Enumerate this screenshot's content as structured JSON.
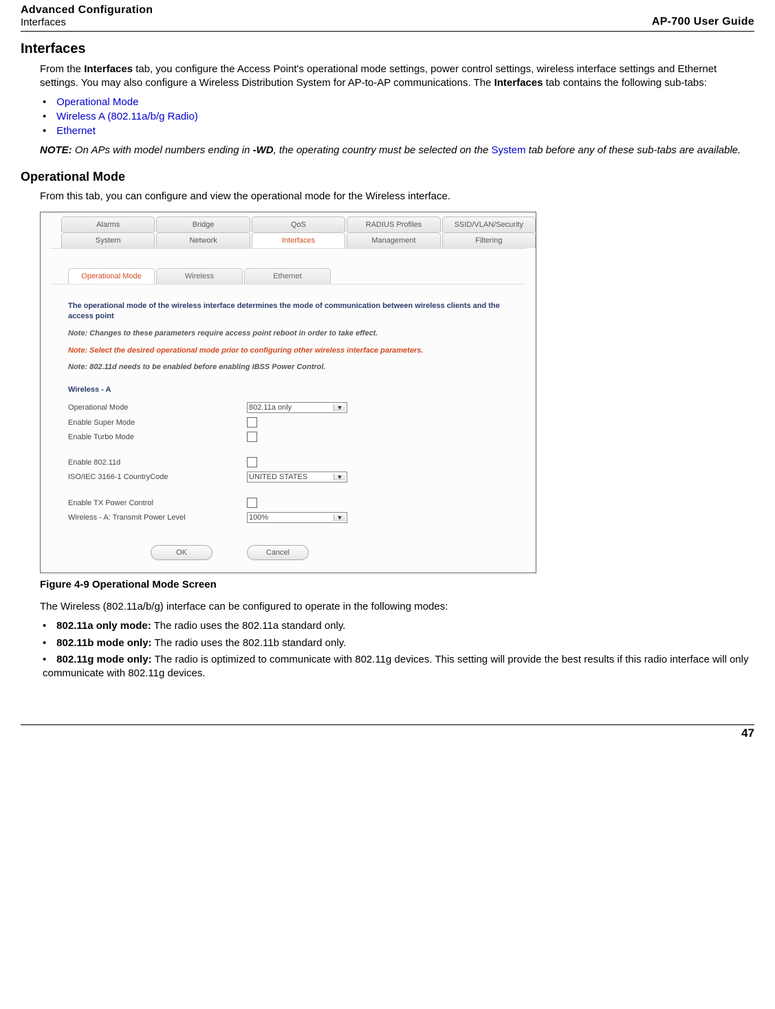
{
  "header": {
    "left_top": "Advanced Configuration",
    "left_bottom": "Interfaces",
    "right": "AP-700 User Guide"
  },
  "section_title": "Interfaces",
  "intro_p1_a": "From the ",
  "intro_p1_b": " tab, you configure the Access Point's operational mode settings, power control settings, wireless interface settings and Ethernet settings. You may also configure a Wireless Distribution System for AP-to-AP communications. The ",
  "intro_p1_c": " tab contains the following sub-tabs:",
  "intro_bold_interfaces": "Interfaces",
  "bullets_links": {
    "op_mode": "Operational Mode",
    "wireless_a": "Wireless A (802.11a/b/g Radio)",
    "ethernet": "Ethernet"
  },
  "note": {
    "label": "NOTE:",
    "a": "On APs with model numbers ending in ",
    "wd": "-WD",
    "b": ", the operating country must be selected on the ",
    "system_link": "System",
    "c": " tab before any of these sub-tabs are available."
  },
  "subsection_title": "Operational Mode",
  "subsection_intro": "From this tab, you can configure and view the operational mode for the Wireless interface.",
  "ui": {
    "toptabs_row1": [
      "Alarms",
      "Bridge",
      "QoS",
      "RADIUS Profiles",
      "SSID/VLAN/Security"
    ],
    "toptabs_row2": [
      "System",
      "Network",
      "Interfaces",
      "Management",
      "Filtering"
    ],
    "active_top_tab": "Interfaces",
    "subtabs": [
      "Operational Mode",
      "Wireless",
      "Ethernet"
    ],
    "active_sub_tab": "Operational Mode",
    "panel_text": {
      "blue": "The operational mode of the wireless interface determines the mode of communication between wireless clients and the access point",
      "note1": "Note: Changes to these parameters require access point reboot in order to take effect.",
      "orange": "Note: Select the desired operational mode prior to configuring other wireless interface parameters.",
      "note2": "Note: 802.11d needs to be enabled before enabling IBSS Power Control.",
      "section_head": "Wireless - A"
    },
    "fields": {
      "operational_mode_label": "Operational Mode",
      "operational_mode_value": "802.11a only",
      "enable_super_mode": "Enable Super Mode",
      "enable_turbo_mode": "Enable Turbo Mode",
      "enable_80211d": "Enable 802.11d",
      "country_code_label": "ISO/IEC 3166-1 CountryCode",
      "country_code_value": "UNITED STATES",
      "enable_tx_power": "Enable TX Power Control",
      "tx_power_level_label": "Wireless - A: Transmit Power Level",
      "tx_power_level_value": "100%"
    },
    "buttons": {
      "ok": "OK",
      "cancel": "Cancel"
    }
  },
  "figure_caption": "Figure 4-9 Operational Mode Screen",
  "post_fig_intro": "The Wireless (802.11a/b/g) interface can be configured to operate in the following modes:",
  "modes": {
    "m1_bold": "802.11a only mode:",
    "m1_rest": " The radio uses the 802.11a standard only.",
    "m2_bold": "802.11b mode only:",
    "m2_rest": " The radio uses the 802.11b standard only.",
    "m3_bold": "802.11g mode only:",
    "m3_rest": " The radio is optimized to communicate with 802.11g devices. This setting will provide the best results if this radio interface will only communicate with 802.11g devices."
  },
  "page_number": "47",
  "bullet_char": "•"
}
